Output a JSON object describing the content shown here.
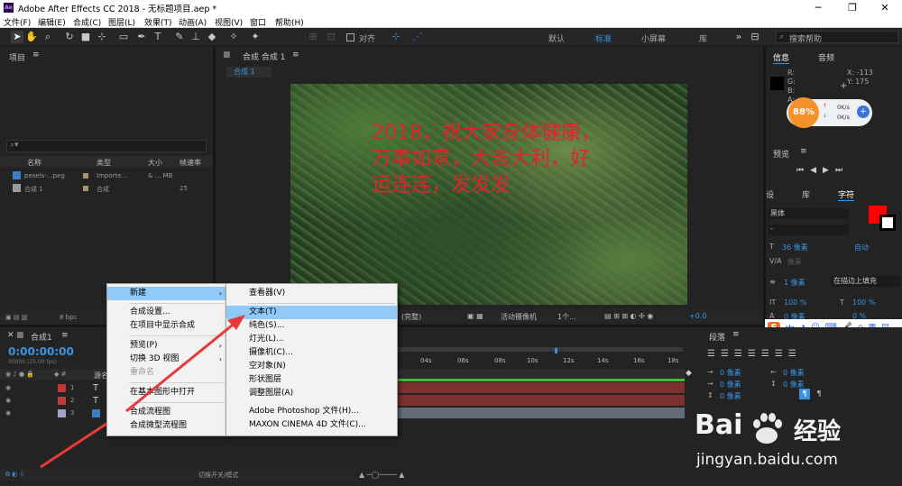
{
  "window": {
    "title": "Adobe After Effects CC 2018 - 无标题项目.aep *",
    "logo": "Ae"
  },
  "menubar": [
    "文件(F)",
    "编辑(E)",
    "合成(C)",
    "图层(L)",
    "效果(T)",
    "动画(A)",
    "视图(V)",
    "窗口",
    "帮助(H)"
  ],
  "toolbar": {
    "align_label": "对齐",
    "workspaces": [
      "默认",
      "标准",
      "小屏幕",
      "库"
    ],
    "active_workspace": "标准",
    "search_placeholder": "搜索帮助"
  },
  "project": {
    "title": "项目",
    "columns": [
      "名称",
      "类型",
      "大小",
      "帧速率"
    ],
    "items": [
      {
        "name": "pexels-...peg",
        "type": "Importe...",
        "size": "& ... MB",
        "fps": ""
      },
      {
        "name": "合成 1",
        "type": "合成",
        "size": "",
        "fps": "25"
      }
    ],
    "bpc": "8 bpc"
  },
  "composition": {
    "tab": "合成 合成 1",
    "subtab": "合成 1",
    "overlay_text": "2018，祝大家身体健康，万事如意，大吉大利，好运连连，发发发",
    "camera": "活动摄像机",
    "views": "1个...",
    "quality": "(完整)",
    "exposure": "+0.0"
  },
  "context_menu": {
    "items": [
      {
        "label": "新建",
        "submenu": true,
        "highlight": true
      },
      {
        "label": "合成设置..."
      },
      {
        "label": "在项目中显示合成"
      },
      {
        "label": "预览(P)",
        "submenu": true
      },
      {
        "label": "切换 3D 视图",
        "submenu": true
      },
      {
        "label": "重命名",
        "disabled": true
      },
      {
        "label": "在基本图形中打开"
      },
      {
        "label": "合成流程图"
      },
      {
        "label": "合成微型流程图"
      }
    ]
  },
  "submenu": {
    "items": [
      {
        "label": "查看器(V)"
      },
      {
        "label": "文本(T)",
        "highlight": true
      },
      {
        "label": "纯色(S)..."
      },
      {
        "label": "灯光(L)..."
      },
      {
        "label": "摄像机(C)..."
      },
      {
        "label": "空对象(N)"
      },
      {
        "label": "形状图层"
      },
      {
        "label": "调整图层(A)"
      },
      {
        "label": "Adobe Photoshop 文件(H)..."
      },
      {
        "label": "MAXON CINEMA 4D 文件(C)..."
      }
    ]
  },
  "timeline": {
    "tab": "合成1",
    "timecode": "0:00:00:00",
    "timecode_sub": "00000 (25.00 fps)",
    "layer_header": "源名",
    "layers": [
      "1",
      "2",
      "3"
    ],
    "ticks": [
      "04s",
      "06s",
      "08s",
      "10s",
      "12s",
      "14s",
      "16s",
      "18s"
    ],
    "footer": "切换开关/模式"
  },
  "info": {
    "tab_info": "信息",
    "tab_audio": "音频",
    "r": "R:",
    "g": "G:",
    "b": "B:",
    "a": "A:",
    "x": "X: -113",
    "y": "Y: 175",
    "net_percent": "88%",
    "net_up": "0K/s",
    "net_down": "0K/s"
  },
  "preview": {
    "title": "预览"
  },
  "character": {
    "tabs": [
      "设",
      "库",
      "字符"
    ],
    "font": "黑体",
    "style": "-",
    "size": "36 像素",
    "leading": "自动",
    "tracking": "像素",
    "stroke_width": "1 像素",
    "stroke_type": "在描边上填充",
    "vscale": "100 %",
    "hscale": "100 %",
    "baseline": "0 像素",
    "tsume": "0 %",
    "colors": {
      "fill": "#ff0000",
      "stroke": "#ffffff"
    }
  },
  "paragraph": {
    "title": "段落",
    "indent": [
      "0 像素",
      "0 像素",
      "0 像素",
      "0 像素",
      "0 像素"
    ]
  },
  "ime": {
    "label": "中"
  },
  "watermark": {
    "brand": "Bai",
    "brand2": "经验",
    "url": "jingyan.baidu.com"
  }
}
